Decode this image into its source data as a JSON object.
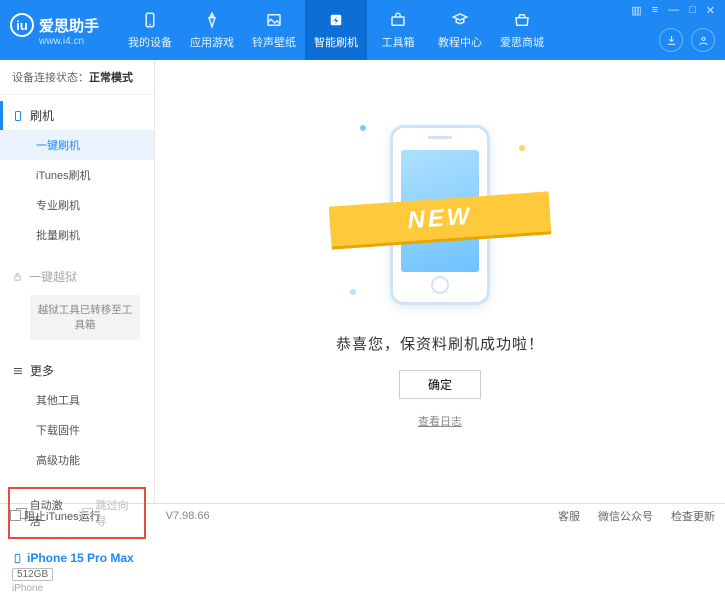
{
  "app": {
    "title": "爱思助手",
    "url": "www.i4.cn"
  },
  "nav": [
    {
      "label": "我的设备"
    },
    {
      "label": "应用游戏"
    },
    {
      "label": "铃声壁纸"
    },
    {
      "label": "智能刷机"
    },
    {
      "label": "工具箱"
    },
    {
      "label": "教程中心"
    },
    {
      "label": "爱思商城"
    }
  ],
  "status": {
    "label": "设备连接状态：",
    "value": "正常模式"
  },
  "sidebar": {
    "flash_header": "刷机",
    "flash_items": [
      "一键刷机",
      "iTunes刷机",
      "专业刷机",
      "批量刷机"
    ],
    "jailbreak_header": "一键越狱",
    "jailbreak_note": "越狱工具已转移至工具箱",
    "more_header": "更多",
    "more_items": [
      "其他工具",
      "下载固件",
      "高级功能"
    ]
  },
  "checkboxes": {
    "auto_activate": "自动激活",
    "skip_guide": "跳过向导"
  },
  "device": {
    "name": "iPhone 15 Pro Max",
    "storage": "512GB",
    "type": "iPhone"
  },
  "main": {
    "ribbon": "NEW",
    "success": "恭喜您，保资料刷机成功啦！",
    "ok": "确定",
    "log_link": "查看日志"
  },
  "footer": {
    "block_itunes": "阻止iTunes运行",
    "version": "V7.98.66",
    "support": "客服",
    "wechat": "微信公众号",
    "update": "检查更新"
  }
}
